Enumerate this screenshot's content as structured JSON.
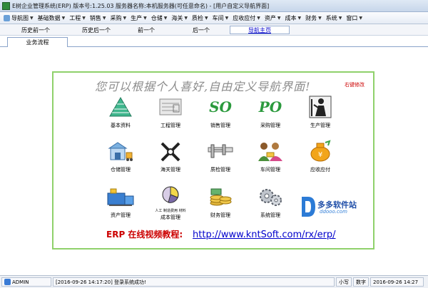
{
  "window": {
    "title": "E树企业管理系统(ERP) 版本号:1.25.03  服务器名称:本机服务器(可任意命名) - [用户自定义导航界面]"
  },
  "menubar": {
    "items": [
      {
        "label": "导航图",
        "icon": "nav-icon"
      },
      {
        "label": "基础数据"
      },
      {
        "label": "工程"
      },
      {
        "label": "销售"
      },
      {
        "label": "采购"
      },
      {
        "label": "生产"
      },
      {
        "label": "仓储"
      },
      {
        "label": "海关"
      },
      {
        "label": "质检"
      },
      {
        "label": "车间"
      },
      {
        "label": "应收应付"
      },
      {
        "label": "资产"
      },
      {
        "label": "成本"
      },
      {
        "label": "财务"
      },
      {
        "label": "系统"
      },
      {
        "label": "窗口"
      }
    ]
  },
  "navbar": {
    "history_back": "历史前一个",
    "history_forward": "历史后一个",
    "prev": "前一个",
    "next": "后一个",
    "home": "导航主页"
  },
  "tabs": [
    {
      "label": "业务流程",
      "active": true
    }
  ],
  "panel": {
    "banner": "您可以根据个人喜好,自由定义导航界面!",
    "banner_note": "右键修改",
    "modules": [
      {
        "label": "基本资料",
        "icon": "pyramid-icon"
      },
      {
        "label": "工程管理",
        "icon": "blueprint-icon"
      },
      {
        "label": "销售管理",
        "icon": "so-icon",
        "icon_text": "SO"
      },
      {
        "label": "采购管理",
        "icon": "po-icon",
        "icon_text": "PO"
      },
      {
        "label": "生产管理",
        "icon": "worker-icon"
      },
      {
        "label": "仓储管理",
        "icon": "warehouse-icon"
      },
      {
        "label": "海关管理",
        "icon": "tools-icon"
      },
      {
        "label": "质检管理",
        "icon": "caliper-icon"
      },
      {
        "label": "车间管理",
        "icon": "team-icon"
      },
      {
        "label": "应收应付",
        "icon": "moneybag-icon"
      },
      {
        "label": "资产管理",
        "icon": "machine-icon"
      },
      {
        "label": "成本管理",
        "icon": "piechart-icon",
        "icon_text": "人工 制造费用 材料"
      },
      {
        "label": "财务管理",
        "icon": "coins-icon"
      },
      {
        "label": "系统管理",
        "icon": "gears-icon"
      }
    ],
    "promo": {
      "name": "多多软件站",
      "domain": "ddooo.com"
    },
    "footer_label": "ERP 在线视频教程:",
    "footer_url": "http://www.kntSoft.com/rx/erp/"
  },
  "statusbar": {
    "user": "ADMIN",
    "message": "[2016-09-26 14:17:20] 登录系统成功!",
    "caps": "小写",
    "num": "数字",
    "datetime": "2016-09-26 14:27"
  },
  "colors": {
    "panel_border": "#8fd16b",
    "footer_label": "#cc0000",
    "link": "#0000cc"
  }
}
